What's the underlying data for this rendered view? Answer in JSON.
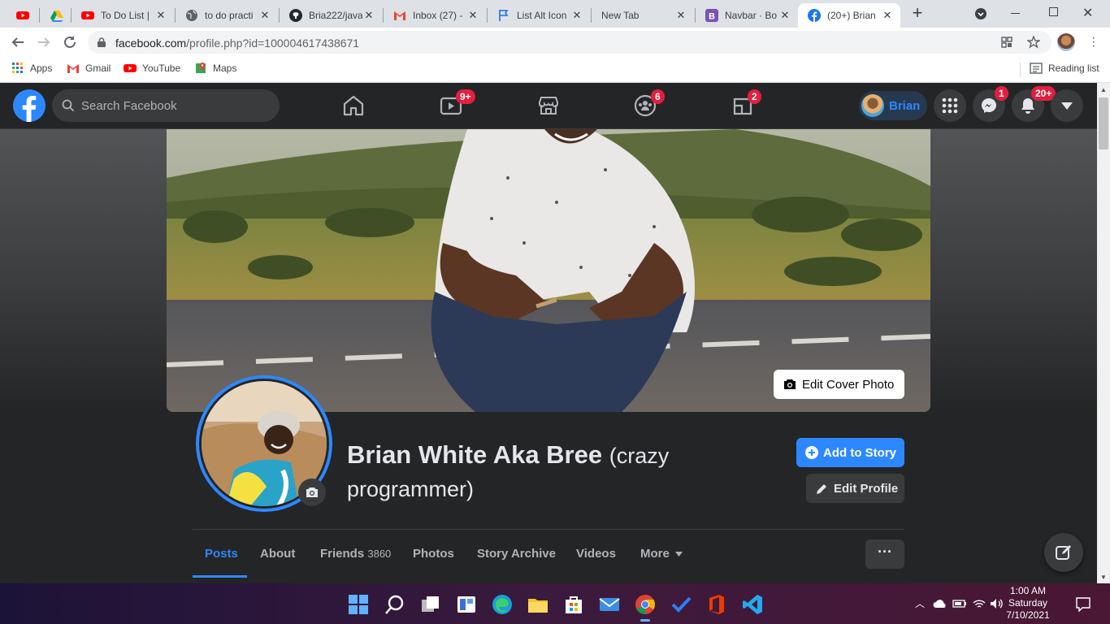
{
  "browser": {
    "tabs": [
      {
        "title": "",
        "icon": "youtube-icon"
      },
      {
        "title": "",
        "icon": "google-drive-icon"
      },
      {
        "title": "To Do List |",
        "icon": "youtube-icon"
      },
      {
        "title": "to do practi",
        "icon": "globe-icon"
      },
      {
        "title": "Bria222/java",
        "icon": "github-icon"
      },
      {
        "title": "Inbox (27) -",
        "icon": "gmail-icon"
      },
      {
        "title": "List Alt Icon",
        "icon": "flag-icon"
      },
      {
        "title": "New Tab",
        "icon": ""
      },
      {
        "title": "Navbar · Bo",
        "icon": "bootstrap-icon"
      },
      {
        "title": "(20+) Brian",
        "icon": "facebook-icon",
        "active": true
      }
    ],
    "url_domain": "facebook.com",
    "url_path": "/profile.php?id=100004617438671",
    "bookmarks": [
      "Apps",
      "Gmail",
      "YouTube",
      "Maps"
    ],
    "reading_list": "Reading list"
  },
  "facebook": {
    "search_placeholder": "Search Facebook",
    "badges": {
      "watch": "9+",
      "groups": "6",
      "gaming": "2",
      "messenger": "1",
      "notifications": "20+"
    },
    "user_chip": "Brian",
    "edit_cover": "Edit Cover Photo",
    "profile_name": "Brian White Aka Bree",
    "profile_nick": "(crazy programmer)",
    "add_story": "Add to Story",
    "edit_profile": "Edit Profile",
    "tabs": {
      "posts": "Posts",
      "about": "About",
      "friends": "Friends",
      "friends_count": "3860",
      "photos": "Photos",
      "story_archive": "Story Archive",
      "videos": "Videos",
      "more": "More"
    },
    "more_dots": "···"
  },
  "taskbar": {
    "time": "1:00 AM",
    "day": "Saturday",
    "date": "7/10/2021"
  },
  "colors": {
    "fb_blue": "#2d88ff",
    "badge_red": "#e41e3f",
    "fb_dark": "#242526"
  }
}
